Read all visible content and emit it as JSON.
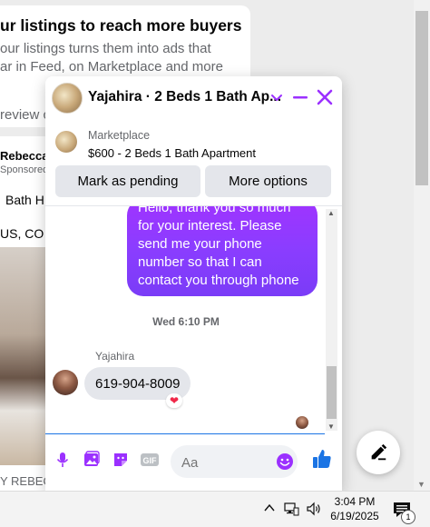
{
  "background": {
    "card_title": "ur listings to reach more buyers",
    "card_desc_line1": "our listings turns them into ads that",
    "card_desc_line2": "ar in Feed, on Marketplace and more",
    "review_text": "review c",
    "post_author": "Rebecca",
    "post_sponsored": "Sponsored",
    "post_snippet1": "Bath H",
    "post_snippet2": "US, CO",
    "bottom_text": "Y REBEC"
  },
  "chat": {
    "title": "Yajahira · 2 Beds 1 Bath Ap...",
    "listing": {
      "source": "Marketplace",
      "name": "$600 - 2 Beds 1 Bath Apartment"
    },
    "buttons": {
      "mark_pending": "Mark as pending",
      "more_options": "More options"
    },
    "messages": {
      "outgoing_text": "Hello, thank you so much\nfor your interest. Please\nsend me your phone\nnumber so that I can\ncontact you through phone",
      "timestamp": "Wed 6:10 PM",
      "sender_name": "Yajahira",
      "incoming_text": "619-904-8009",
      "reaction": "❤"
    },
    "composer": {
      "placeholder": "Aa"
    },
    "colors": {
      "accent": "#9b30ff",
      "like": "#1b74e4"
    }
  },
  "taskbar": {
    "time": "3:04 PM",
    "date": "6/19/2025",
    "notification_count": "1"
  }
}
